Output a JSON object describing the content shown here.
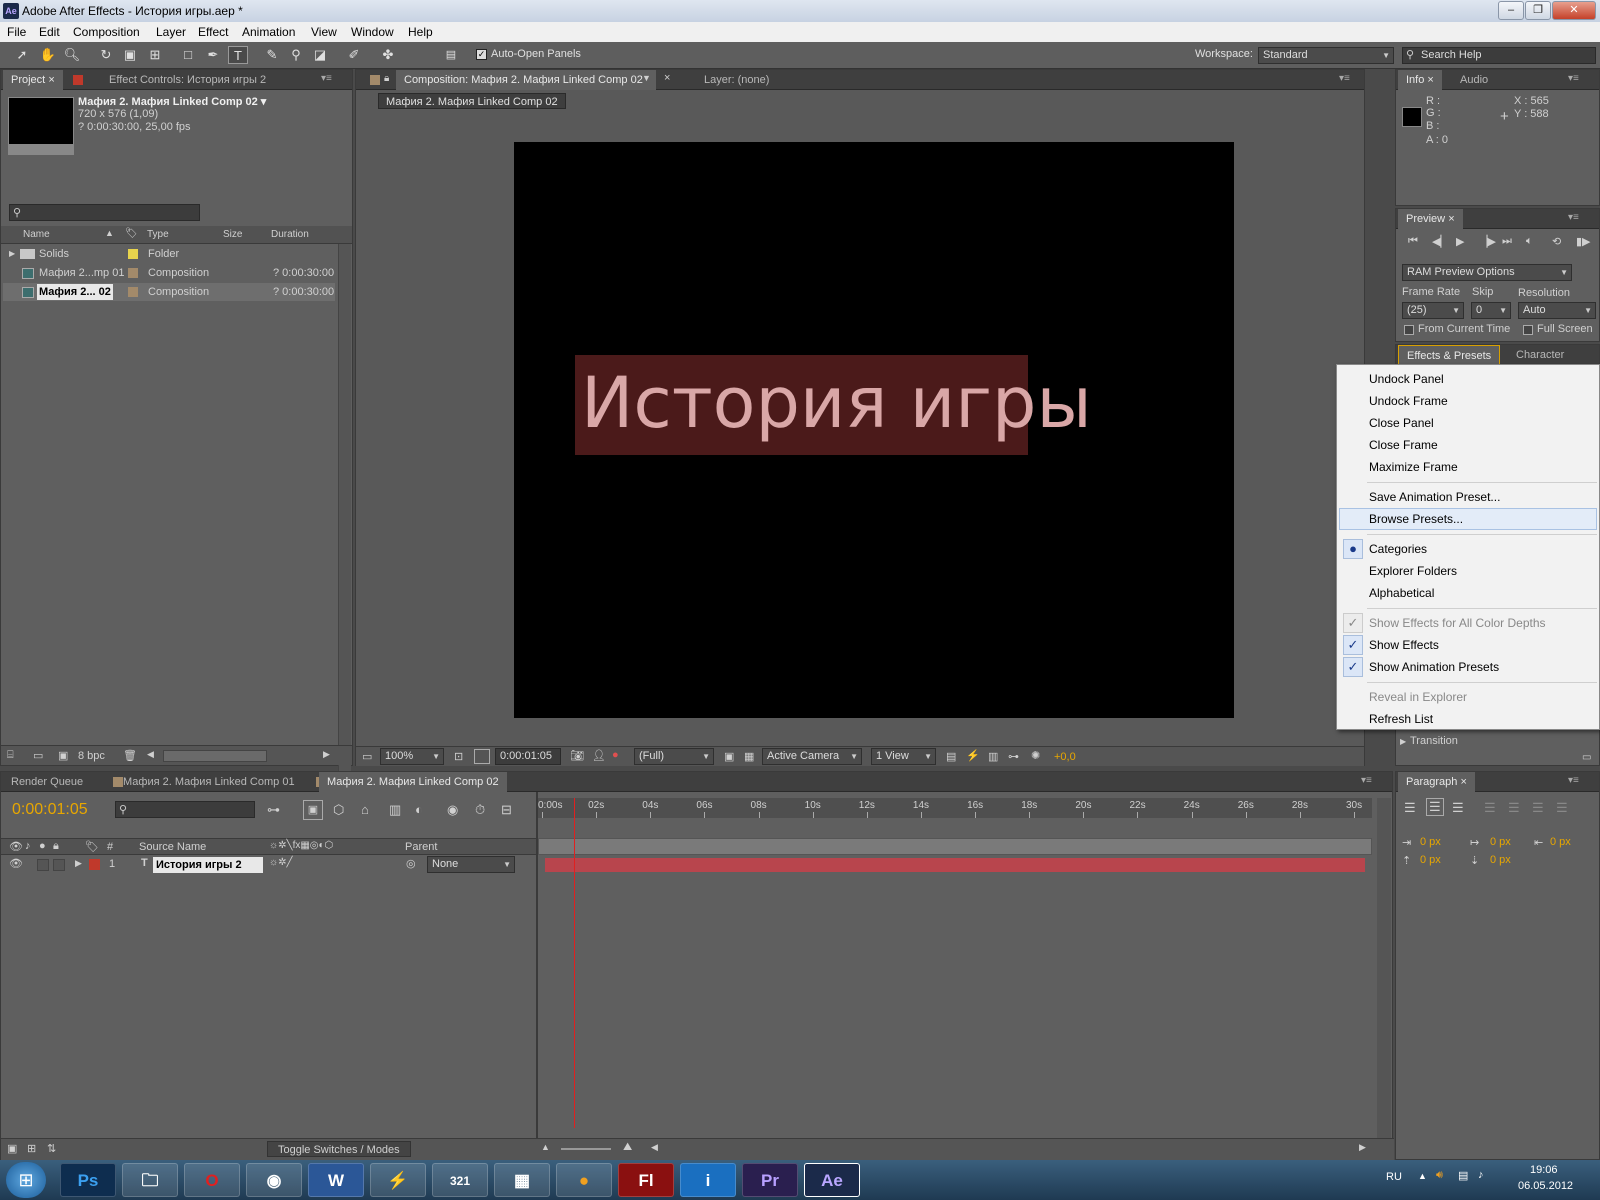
{
  "window": {
    "title": "Adobe After Effects - История игры.aep *",
    "app_icon": "Ae"
  },
  "menu": [
    "File",
    "Edit",
    "Composition",
    "Layer",
    "Effect",
    "Animation",
    "View",
    "Window",
    "Help"
  ],
  "toolbar": {
    "auto_open": "Auto-Open Panels",
    "workspace_label": "Workspace:",
    "workspace": "Standard",
    "search": "Search Help"
  },
  "project": {
    "tabs": [
      "Project",
      "Effect Controls: История игры 2"
    ],
    "comp_name": "Мафия 2. Мафия Linked Comp 02 ▾",
    "comp_size": "720 x 576 (1,09)",
    "comp_duration": "? 0:00:30:00, 25,00 fps",
    "columns": [
      "Name",
      "Type",
      "Size",
      "Duration"
    ],
    "items": [
      {
        "name": "Solids",
        "type": "Folder",
        "duration": ""
      },
      {
        "name": "Мафия 2...mp 01",
        "type": "Composition",
        "duration": "? 0:00:30:00"
      },
      {
        "name": "Мафия 2... 02",
        "type": "Composition",
        "duration": "? 0:00:30:00"
      }
    ],
    "bpc": "8 bpc"
  },
  "comp": {
    "tab": "Composition: Мафия 2. Мафия Linked Comp 02",
    "layer_tab": "Layer: (none)",
    "breadcrumb": "Мафия 2. Мафия Linked Comp 02",
    "text": "История игры",
    "zoom": "100%",
    "time": "0:00:01:05",
    "resolution": "(Full)",
    "camera": "Active Camera",
    "view": "1 View",
    "exposure": "+0,0"
  },
  "info": {
    "tabs": [
      "Info",
      "Audio"
    ],
    "r": "R :",
    "g": "G :",
    "b": "B :",
    "a": "A : 0",
    "x": "X : 565",
    "y": "Y : 588"
  },
  "preview": {
    "tab": "Preview",
    "ram": "RAM Preview Options",
    "frame_rate_label": "Frame Rate",
    "skip_label": "Skip",
    "resolution_label": "Resolution",
    "frame_rate": "(25)",
    "skip": "0",
    "resolution": "Auto",
    "from_current": "From Current Time",
    "full_screen": "Full Screen"
  },
  "effects": {
    "tabs": [
      "Effects & Presets",
      "Character"
    ],
    "transition": "Transition"
  },
  "context_menu": {
    "group1": [
      "Undock Panel",
      "Undock Frame",
      "Close Panel",
      "Close Frame",
      "Maximize Frame"
    ],
    "group2": [
      "Save Animation Preset...",
      "Browse Presets..."
    ],
    "group3": [
      "Categories",
      "Explorer Folders",
      "Alphabetical"
    ],
    "group4": [
      "Show Effects for All Color Depths",
      "Show Effects",
      "Show Animation Presets"
    ],
    "group5": [
      "Reveal in Explorer",
      "Refresh List"
    ]
  },
  "timeline": {
    "tabs": [
      "Render Queue",
      "Мафия 2. Мафия Linked Comp 01",
      "Мафия 2. Мафия Linked Comp 02"
    ],
    "time": "0:00:01:05",
    "col_source": "Source Name",
    "col_parent": "Parent",
    "col_num": "#",
    "layer_num": "1",
    "layer_name": "История игры 2",
    "parent": "None",
    "ruler": [
      "0:00s",
      "02s",
      "04s",
      "06s",
      "08s",
      "10s",
      "12s",
      "14s",
      "16s",
      "18s",
      "20s",
      "22s",
      "24s",
      "26s",
      "28s",
      "30s"
    ],
    "toggle": "Toggle Switches / Modes"
  },
  "paragraph": {
    "tab": "Paragraph",
    "v1": "0 px",
    "v2": "0 px",
    "v3": "0 px",
    "v4": "0 px",
    "v5": "0 px"
  },
  "taskbar": {
    "apps": [
      "Ps",
      "",
      "",
      "",
      "W",
      "",
      "321",
      "",
      "",
      "Fl",
      "i",
      "Pr",
      "Ae"
    ],
    "lang": "RU",
    "time": "19:06",
    "date": "06.05.2012"
  }
}
